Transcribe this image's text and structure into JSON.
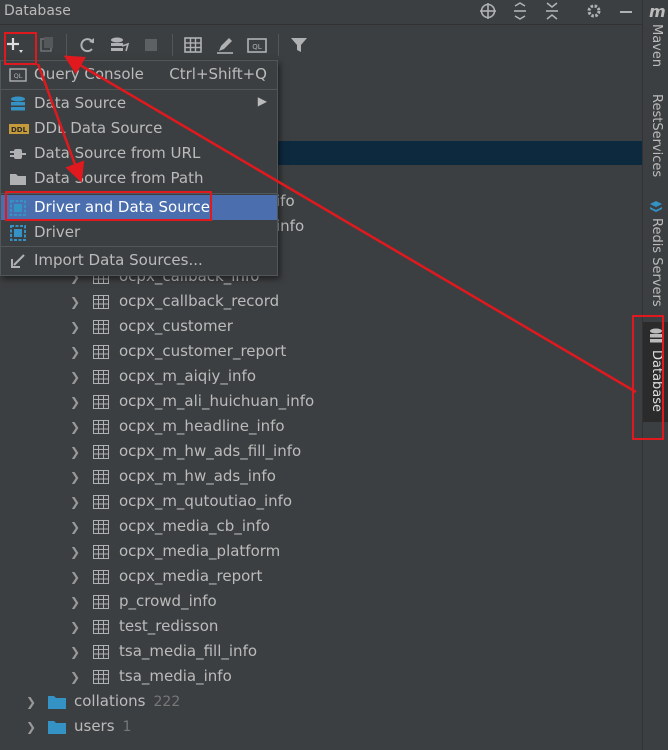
{
  "window": {
    "title": "Database"
  },
  "toolbar": {
    "items": [
      "add-icon",
      "duplicate-icon",
      "refresh-icon",
      "sync-schema-icon",
      "stop-icon",
      "table-view-icon",
      "edit-icon",
      "query-console-icon",
      "filter-icon"
    ]
  },
  "title_actions": [
    "locate-icon",
    "expand-all-icon",
    "collapse-all-icon",
    "settings-icon",
    "minimize-icon"
  ],
  "menu": {
    "items": [
      {
        "label": "Query Console",
        "shortcut": "Ctrl+Shift+Q",
        "icon": "query-console-icon"
      },
      {
        "label": "Data Source",
        "submenu": true,
        "icon": "database-icon"
      },
      {
        "label": "DDL Data Source",
        "icon": "ddl-icon"
      },
      {
        "label": "Data Source from URL",
        "icon": "plug-icon"
      },
      {
        "label": "Data Source from Path",
        "icon": "folder-icon"
      },
      {
        "label": "Driver and Data Source",
        "icon": "driver-icon",
        "highlighted": true
      },
      {
        "label": "Driver",
        "icon": "driver-icon"
      },
      {
        "label": "Import Data Sources...",
        "icon": "import-icon"
      }
    ]
  },
  "tree": {
    "partial_rows": [
      "ifo",
      "info"
    ],
    "tables": [
      "ocpx_callback_info",
      "ocpx_callback_record",
      "ocpx_customer",
      "ocpx_customer_report",
      "ocpx_m_aiqiy_info",
      "ocpx_m_ali_huichuan_info",
      "ocpx_m_headline_info",
      "ocpx_m_hw_ads_fill_info",
      "ocpx_m_hw_ads_info",
      "ocpx_m_qutoutiao_info",
      "ocpx_media_cb_info",
      "ocpx_media_platform",
      "ocpx_media_report",
      "p_crowd_info",
      "test_redisson",
      "tsa_media_fill_info",
      "tsa_media_info"
    ],
    "folders": [
      {
        "label": "collations",
        "count": "222"
      },
      {
        "label": "users",
        "count": "1"
      }
    ]
  },
  "right_stripe": {
    "logo": "m",
    "tabs": [
      "Maven",
      "RestServices",
      "Redis Servers",
      "Database"
    ]
  },
  "colors": {
    "background": "#3c3f41",
    "selection": "#0d293e",
    "menu_highlight": "#4b6eaf",
    "annotation": "#e0191e"
  }
}
